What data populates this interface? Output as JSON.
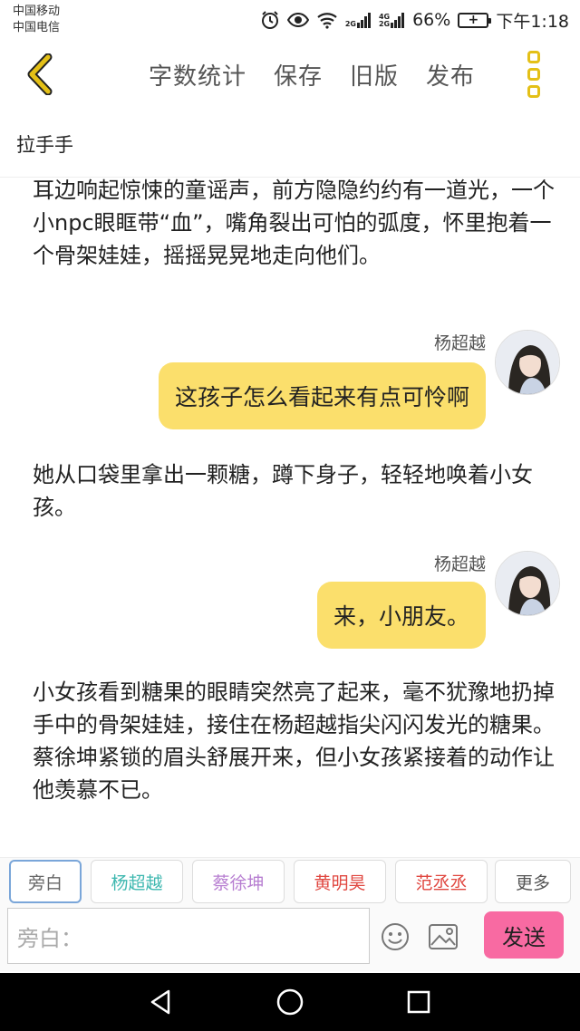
{
  "status_bar": {
    "carrier1": "中国移动",
    "carrier2": "中国电信",
    "net1": "2G",
    "net2_top": "4G",
    "net2_bottom": "2G",
    "battery": "66%",
    "time": "下午1:18"
  },
  "toolbar": {
    "actions": [
      "字数统计",
      "保存",
      "旧版",
      "发布"
    ],
    "accent": "#e4c017"
  },
  "story": {
    "title": "拉手手",
    "blocks": [
      {
        "type": "narration",
        "text": "耳边响起惊悚的童谣声，前方隐隐约约有一道光，一个小npc眼眶带“血”，嘴角裂出可怕的弧度，怀里抱着一个骨架娃娃，摇摇晃晃地走向他们。"
      },
      {
        "type": "dialogue",
        "speaker": "杨超越",
        "text": "这孩子怎么看起来有点可怜啊"
      },
      {
        "type": "narration",
        "text": "她从口袋里拿出一颗糖，蹲下身子，轻轻地唤着小女孩。"
      },
      {
        "type": "dialogue",
        "speaker": "杨超越",
        "text": "来，小朋友。"
      },
      {
        "type": "narration",
        "text": "小女孩看到糖果的眼睛突然亮了起来，毫不犹豫地扔掉手中的骨架娃娃，接住在杨超越指尖闪闪发光的糖果。蔡徐坤紧锁的眉头舒展开来，但小女孩紧接着的动作让他羡慕不已。"
      }
    ]
  },
  "roles": [
    {
      "label": "旁白",
      "color": "#666666",
      "active": true
    },
    {
      "label": "杨超越",
      "color": "#3fb8b0"
    },
    {
      "label": "蔡徐坤",
      "color": "#b77ed1"
    },
    {
      "label": "黄明昊",
      "color": "#e0463f"
    },
    {
      "label": "范丞丞",
      "color": "#e0463f"
    },
    {
      "label": "更多",
      "color": "#555555"
    }
  ],
  "input": {
    "placeholder": "旁白：",
    "send_label": "发送",
    "send_color": "#f86aa2"
  },
  "bubble_color": "#fbdf6c"
}
